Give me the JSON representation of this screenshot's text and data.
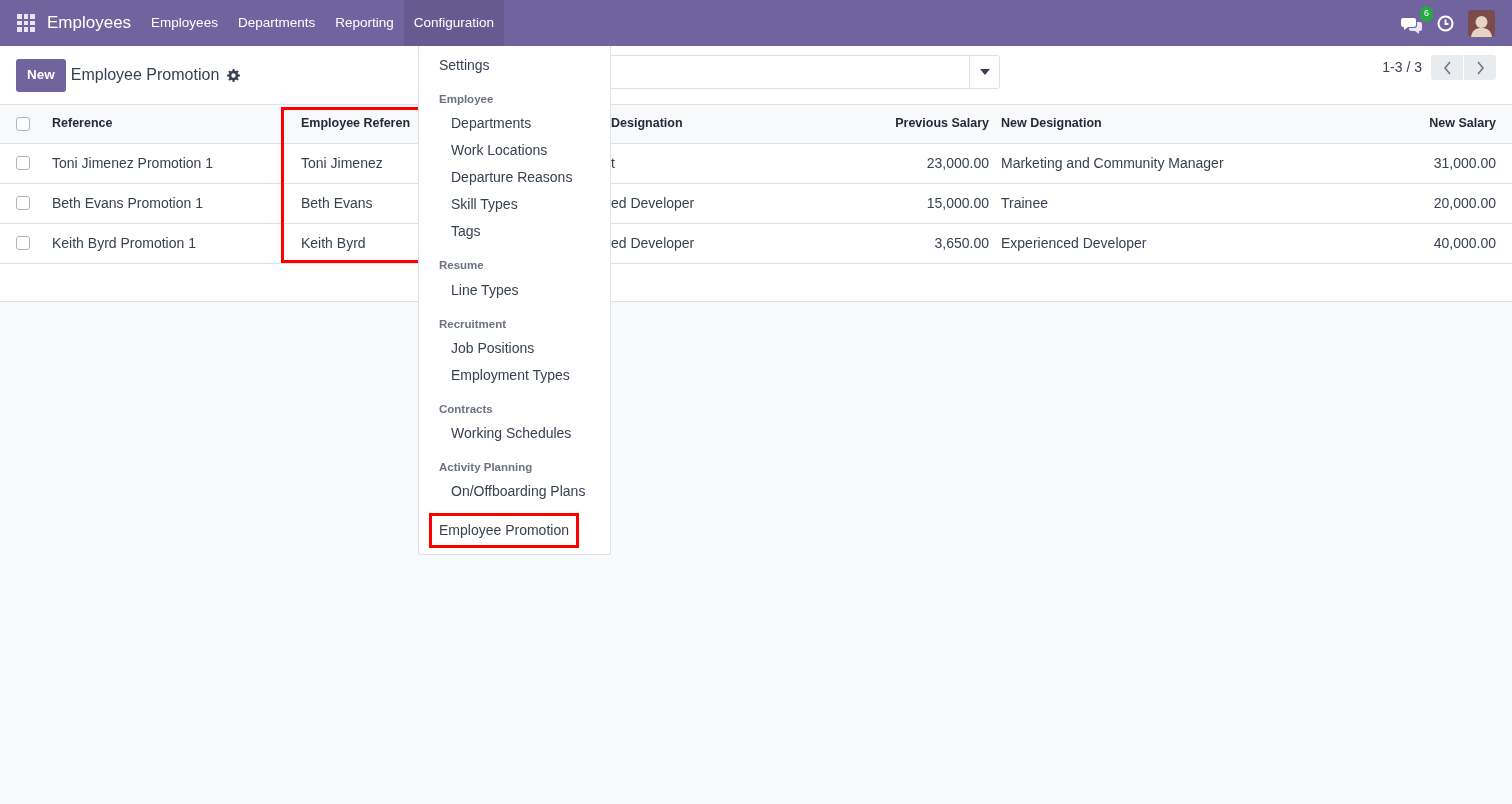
{
  "navbar": {
    "app_name": "Employees",
    "menu": [
      {
        "label": "Employees",
        "selected": false
      },
      {
        "label": "Departments",
        "selected": false
      },
      {
        "label": "Reporting",
        "selected": false
      },
      {
        "label": "Configuration",
        "selected": true
      }
    ],
    "messages_badge": "6"
  },
  "control_panel": {
    "new_button": "New",
    "title": "Employee Promotion",
    "pager": "1-3 / 3"
  },
  "table": {
    "select_all_checked": false,
    "columns": [
      {
        "label": "Reference",
        "kind": "text"
      },
      {
        "label": "Employee Referen",
        "kind": "text",
        "highlighted": true
      },
      {
        "label": "Designation",
        "kind": "text",
        "partly_hidden": true
      },
      {
        "label": "Previous Salary",
        "kind": "amount"
      },
      {
        "label": "New Designation",
        "kind": "text"
      },
      {
        "label": "New Salary",
        "kind": "amount"
      }
    ],
    "rows": [
      {
        "checked": false,
        "cells": [
          "Toni Jimenez Promotion 1",
          "Toni Jimenez",
          "t",
          "23,000.00",
          "Marketing and Community Manager",
          "31,000.00"
        ]
      },
      {
        "checked": false,
        "cells": [
          "Beth Evans Promotion 1",
          "Beth Evans",
          "ed Developer",
          "15,000.00",
          "Trainee",
          "20,000.00"
        ]
      },
      {
        "checked": false,
        "cells": [
          "Keith Byrd Promotion 1",
          "Keith Byrd",
          "ed Developer",
          "3,650.00",
          "Experienced Developer",
          "40,000.00"
        ]
      }
    ]
  },
  "dropdown": {
    "items": [
      {
        "kind": "item",
        "label": "Settings",
        "highlighted": false
      },
      {
        "kind": "header",
        "label": "Employee"
      },
      {
        "kind": "subitem",
        "label": "Departments"
      },
      {
        "kind": "subitem",
        "label": "Work Locations"
      },
      {
        "kind": "subitem",
        "label": "Departure Reasons"
      },
      {
        "kind": "subitem",
        "label": "Skill Types"
      },
      {
        "kind": "subitem",
        "label": "Tags"
      },
      {
        "kind": "header",
        "label": "Resume"
      },
      {
        "kind": "subitem",
        "label": "Line Types"
      },
      {
        "kind": "header",
        "label": "Recruitment"
      },
      {
        "kind": "subitem",
        "label": "Job Positions"
      },
      {
        "kind": "subitem",
        "label": "Employment Types"
      },
      {
        "kind": "header",
        "label": "Contracts"
      },
      {
        "kind": "subitem",
        "label": "Working Schedules"
      },
      {
        "kind": "header",
        "label": "Activity Planning"
      },
      {
        "kind": "subitem",
        "label": "On/Offboarding Plans"
      },
      {
        "kind": "item",
        "label": "Employee Promotion",
        "highlighted": true
      }
    ]
  }
}
